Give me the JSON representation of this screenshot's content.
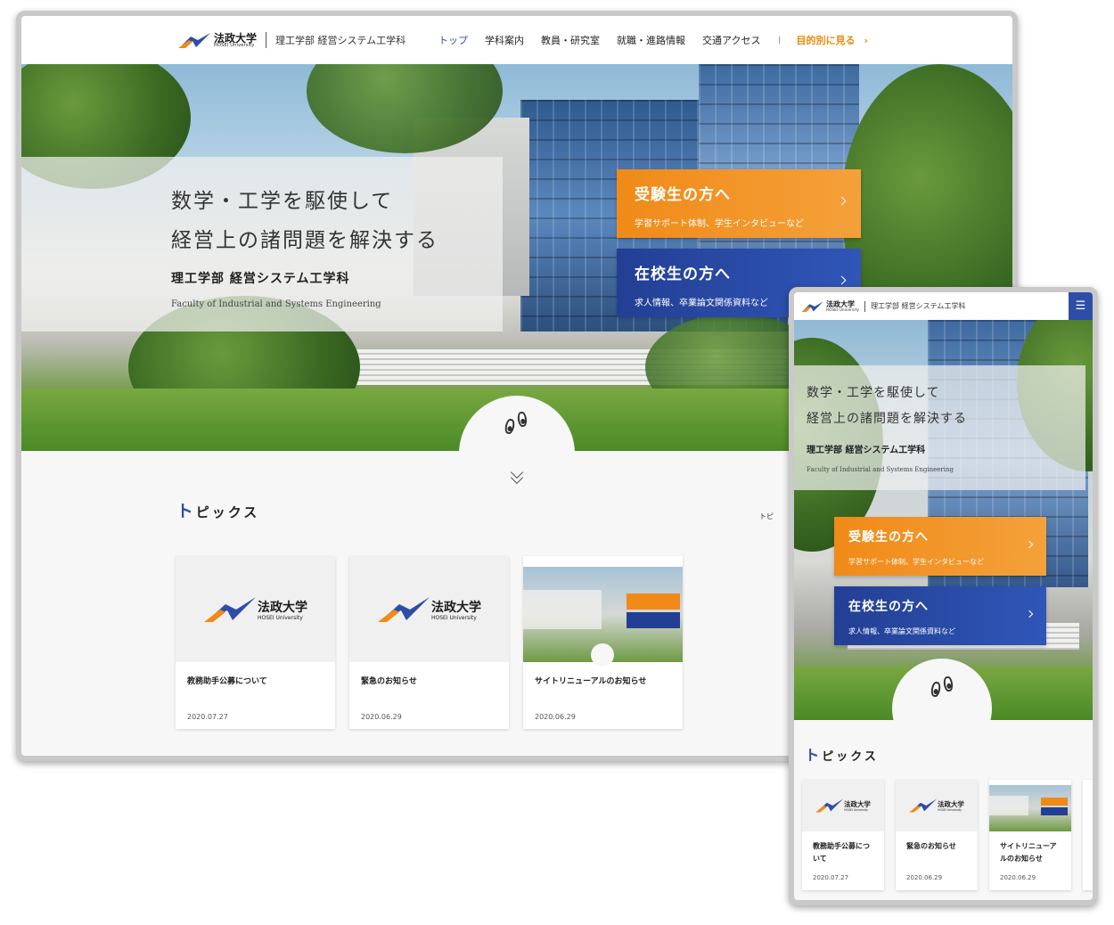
{
  "site": {
    "logo_jp": "法政大学",
    "logo_en": "HOSEI University",
    "dept": "理工学部 経営システム工学科"
  },
  "nav": {
    "items": [
      "トップ",
      "学科案内",
      "教員・研究室",
      "就職・進路情報",
      "交通アクセス"
    ],
    "purpose": "目的別に見る"
  },
  "hero": {
    "line1": "数学・工学を駆使して",
    "line2": "経営上の諸問題を解決する",
    "dept": "理工学部 経営システム工学科",
    "dept_en": "Faculty of Industrial and Systems Engineering"
  },
  "cta": {
    "applicants_title": "受験生の方へ",
    "applicants_sub": "学習サポート体制、学生インタビューなど",
    "students_title": "在校生の方へ",
    "students_sub": "求人情報、卒業論文関係資料など"
  },
  "topics": {
    "title_first": "ト",
    "title_rest": "ピックス",
    "cards": [
      {
        "title": "教務助手公募について",
        "date": "2020.07.27"
      },
      {
        "title": "緊急のお知らせ",
        "date": "2020.06.29"
      },
      {
        "title": "サイトリニューアルのお知らせ",
        "date": "2020.06.29"
      }
    ]
  },
  "mobile": {
    "menu_icon": "☰",
    "card_titles": [
      "教務助手公募につ\nいて",
      "緊急のお知らせ",
      "サイトリニューア\nルのお知らせ"
    ]
  },
  "edge_text": "トピ",
  "colors": {
    "accent_blue": "#2e4da6",
    "accent_orange": "#e98a0c"
  }
}
